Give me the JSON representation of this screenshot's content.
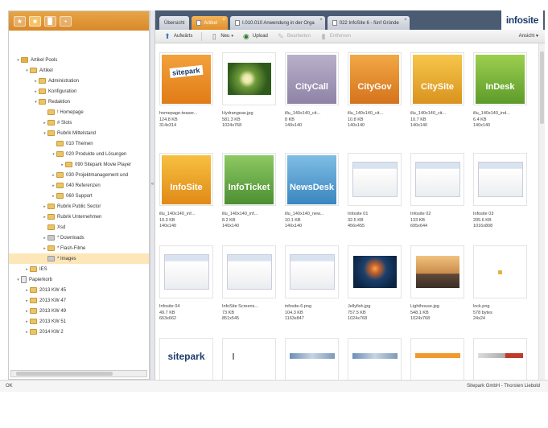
{
  "left_toolbar": {
    "buttons": [
      "★",
      "■",
      "▉",
      "▪"
    ]
  },
  "tree": [
    {
      "label": "Artikel Pools",
      "indent": 0,
      "twisty": "▾",
      "icon": "root"
    },
    {
      "label": "Artikel",
      "indent": 1,
      "twisty": "▾",
      "icon": "folder"
    },
    {
      "label": "Administration",
      "indent": 2,
      "twisty": "▸",
      "icon": "folder"
    },
    {
      "label": "Konfiguration",
      "indent": 2,
      "twisty": "▸",
      "icon": "folder"
    },
    {
      "label": "Redaktion",
      "indent": 2,
      "twisty": "▾",
      "icon": "folder"
    },
    {
      "label": "! Homepage",
      "indent": 3,
      "twisty": "",
      "icon": "folder"
    },
    {
      "label": "# Slots",
      "indent": 3,
      "twisty": "▸",
      "icon": "folder"
    },
    {
      "label": "Rubrik Mittelstand",
      "indent": 3,
      "twisty": "▾",
      "icon": "folder"
    },
    {
      "label": "010 Themen",
      "indent": 4,
      "twisty": "",
      "icon": "folder"
    },
    {
      "label": "020 Produkte und Lösungen",
      "indent": 4,
      "twisty": "▾",
      "icon": "folder"
    },
    {
      "label": "090 Sitepark Movie Player",
      "indent": 5,
      "twisty": "▸",
      "icon": "folder"
    },
    {
      "label": "030 Projektmanagement und",
      "indent": 4,
      "twisty": "▸",
      "icon": "folder"
    },
    {
      "label": "040 Referenzen",
      "indent": 4,
      "twisty": "▸",
      "icon": "folder"
    },
    {
      "label": "060 Support",
      "indent": 4,
      "twisty": "▸",
      "icon": "folder"
    },
    {
      "label": "Rubrik Public Sector",
      "indent": 3,
      "twisty": "▸",
      "icon": "folder"
    },
    {
      "label": "Rubrik Unternehmen",
      "indent": 3,
      "twisty": "▸",
      "icon": "folder"
    },
    {
      "label": "Xsd",
      "indent": 3,
      "twisty": "",
      "icon": "folder"
    },
    {
      "label": "* Downloads",
      "indent": 3,
      "twisty": "▸",
      "icon": "grey"
    },
    {
      "label": "* Flash-Filme",
      "indent": 3,
      "twisty": "▸",
      "icon": "folder"
    },
    {
      "label": "* Images",
      "indent": 3,
      "twisty": "",
      "icon": "grey",
      "selected": true
    },
    {
      "label": "IES",
      "indent": 1,
      "twisty": "▸",
      "icon": "folder"
    },
    {
      "label": "Papierkorb",
      "indent": 0,
      "twisty": "▾",
      "icon": "trash"
    },
    {
      "label": "2013 KW 45",
      "indent": 1,
      "twisty": "▸",
      "icon": "folder"
    },
    {
      "label": "2013 KW 47",
      "indent": 1,
      "twisty": "▸",
      "icon": "folder"
    },
    {
      "label": "2013 KW 49",
      "indent": 1,
      "twisty": "▸",
      "icon": "folder"
    },
    {
      "label": "2013 KW 51",
      "indent": 1,
      "twisty": "▸",
      "icon": "folder"
    },
    {
      "label": "2014 KW 2",
      "indent": 1,
      "twisty": "▸",
      "icon": "folder"
    }
  ],
  "tabs": [
    {
      "label": "Übersicht",
      "active": false,
      "closable": false
    },
    {
      "label": "Artikel",
      "active": true,
      "closable": true
    },
    {
      "label": "I.010.010 Anwendung in der Orga",
      "active": false,
      "closable": true
    },
    {
      "label": "022 InfoSite 6 - fünf Gründe",
      "active": false,
      "closable": true
    }
  ],
  "brand": {
    "name": "infosite"
  },
  "toolbar": {
    "up": "Aufwärts",
    "new": "Neu",
    "upload": "Upload",
    "edit": "Bearbeiten",
    "delete": "Entfernen",
    "view": "Ansicht"
  },
  "assets": [
    {
      "name": "homepage-teaser...",
      "size": "124.8 KB",
      "dims": "314x314",
      "thumb": "sitepark-card",
      "text": "sitepark"
    },
    {
      "name": "Hydrangeas.jpg",
      "size": "581.3 KB",
      "dims": "1024x768",
      "thumb": "flower",
      "text": ""
    },
    {
      "name": "illu_140x140_cit...",
      "size": "8 KB",
      "dims": "140x140",
      "thumb": "citycall",
      "text": "CityCall"
    },
    {
      "name": "illu_140x140_cit...",
      "size": "10.8 KB",
      "dims": "140x140",
      "thumb": "citygov",
      "text": "CityGov"
    },
    {
      "name": "illu_140x140_cit...",
      "size": "10.7 KB",
      "dims": "140x140",
      "thumb": "citysite",
      "text": "CitySite"
    },
    {
      "name": "illu_140x140_ind...",
      "size": "6.4 KB",
      "dims": "140x140",
      "thumb": "indesk",
      "text": "InDesk"
    },
    {
      "name": "illu_140x140_inf...",
      "size": "10.3 KB",
      "dims": "140x140",
      "thumb": "infosite",
      "text": "InfoSite"
    },
    {
      "name": "illu_140x140_inf...",
      "size": "8.2 KB",
      "dims": "140x140",
      "thumb": "infoticket",
      "text": "InfoTicket"
    },
    {
      "name": "illu_140x140_new...",
      "size": "10.1 KB",
      "dims": "140x140",
      "thumb": "newsdesk",
      "text": "NewsDesk"
    },
    {
      "name": "Infosite 01",
      "size": "32.5 KB",
      "dims": "456x455",
      "thumb": "screen",
      "text": ""
    },
    {
      "name": "Infosite 02",
      "size": "133 KB",
      "dims": "695x644",
      "thumb": "screen2",
      "text": ""
    },
    {
      "name": "Infosite 03",
      "size": "205.6 KB",
      "dims": "1016x808",
      "thumb": "screen3",
      "text": ""
    },
    {
      "name": "Infosite 04",
      "size": "49.7 KB",
      "dims": "663x662",
      "thumb": "screen4",
      "text": ""
    },
    {
      "name": "InfoSite Screens...",
      "size": "73 KB",
      "dims": "851x545",
      "thumb": "screen5",
      "text": ""
    },
    {
      "name": "infosite-6.png",
      "size": "104.3 KB",
      "dims": "1163x847",
      "thumb": "screen6",
      "text": ""
    },
    {
      "name": "Jellyfish.jpg",
      "size": "757.5 KB",
      "dims": "1024x768",
      "thumb": "jellyfish",
      "text": ""
    },
    {
      "name": "Lighthouse.jpg",
      "size": "548.1 KB",
      "dims": "1024x768",
      "thumb": "lighthouse",
      "text": ""
    },
    {
      "name": "lock.png",
      "size": "578 bytes",
      "dims": "24x24",
      "thumb": "lock",
      "text": ""
    },
    {
      "name": "",
      "size": "",
      "dims": "",
      "thumb": "sitepark-logo",
      "text": "sitepark"
    },
    {
      "name": "",
      "size": "",
      "dims": "",
      "thumb": "bar",
      "text": ""
    },
    {
      "name": "",
      "size": "",
      "dims": "",
      "thumb": "strip",
      "text": ""
    },
    {
      "name": "",
      "size": "",
      "dims": "",
      "thumb": "strip2",
      "text": ""
    },
    {
      "name": "",
      "size": "",
      "dims": "",
      "thumb": "orange-bar",
      "text": ""
    },
    {
      "name": "",
      "size": "",
      "dims": "",
      "thumb": "red-strip",
      "text": ""
    }
  ],
  "status": {
    "left": "OK",
    "right": "Sitepark GmbH - Thorsten Liebold"
  },
  "colors": {
    "accent": "#e39a35",
    "tabbar": "#4a5b72",
    "selection": "#fde6b8"
  }
}
